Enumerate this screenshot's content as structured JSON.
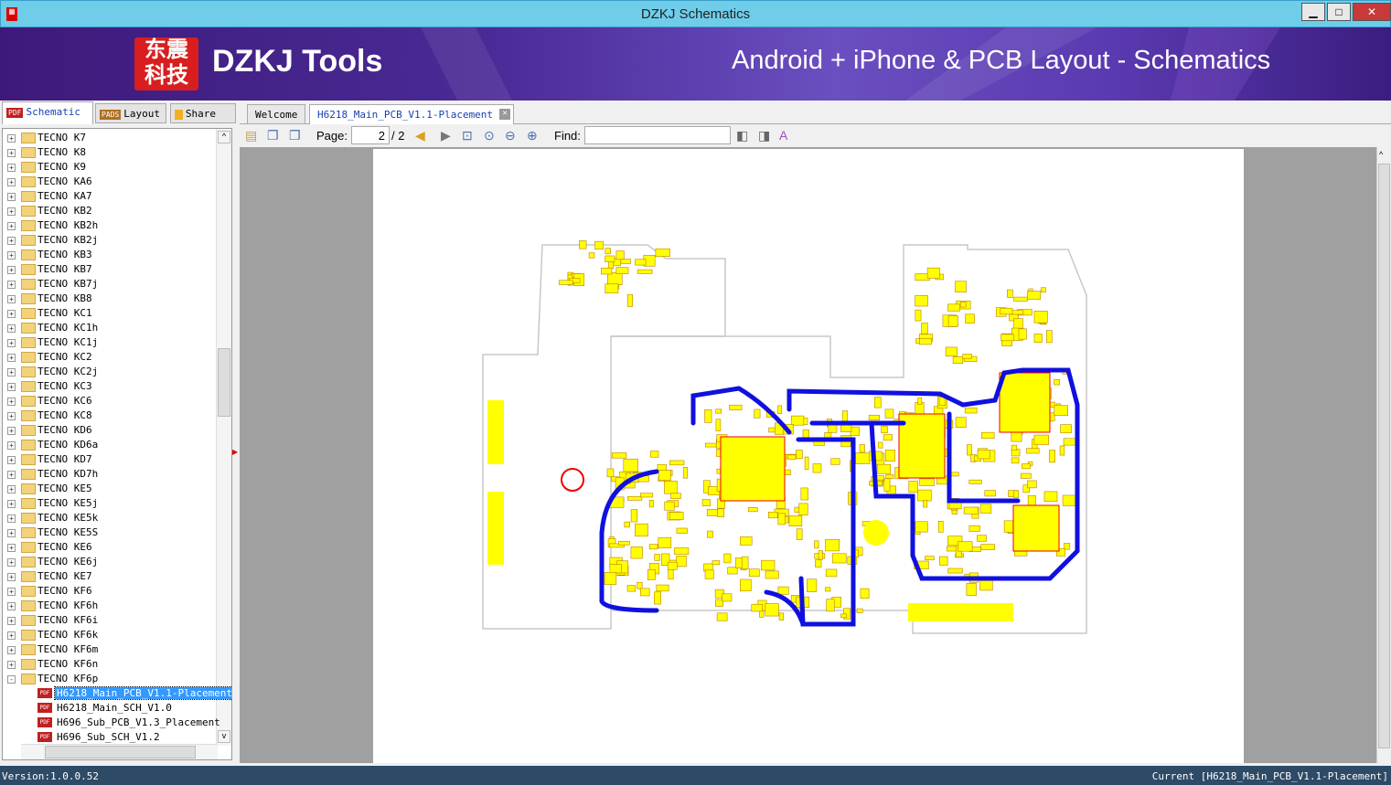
{
  "window": {
    "title": "DZKJ Schematics",
    "minimize": "▁",
    "maximize": "□",
    "close": "✕"
  },
  "banner": {
    "logo_text": "东震科技",
    "brand": "DZKJ Tools",
    "tagline": "Android + iPhone & PCB Layout - Schematics"
  },
  "left_tabs": [
    {
      "label": "Schematic",
      "icon": "PDF"
    },
    {
      "label": "Layout",
      "icon": "PADS"
    },
    {
      "label": "Share",
      "icon": "cloud"
    }
  ],
  "tree": {
    "folders": [
      "TECNO K7",
      "TECNO K8",
      "TECNO K9",
      "TECNO KA6",
      "TECNO KA7",
      "TECNO KB2",
      "TECNO KB2h",
      "TECNO KB2j",
      "TECNO KB3",
      "TECNO KB7",
      "TECNO KB7j",
      "TECNO KB8",
      "TECNO KC1",
      "TECNO KC1h",
      "TECNO KC1j",
      "TECNO KC2",
      "TECNO KC2j",
      "TECNO KC3",
      "TECNO KC6",
      "TECNO KC8",
      "TECNO KD6",
      "TECNO KD6a",
      "TECNO KD7",
      "TECNO KD7h",
      "TECNO KE5",
      "TECNO KE5j",
      "TECNO KE5k",
      "TECNO KE5S",
      "TECNO KE6",
      "TECNO KE6j",
      "TECNO KE7",
      "TECNO KF6",
      "TECNO KF6h",
      "TECNO KF6i",
      "TECNO KF6k",
      "TECNO KF6m",
      "TECNO KF6n",
      "TECNO KF6p"
    ],
    "files": [
      "H6218_Main_PCB_V1.1-Placement",
      "H6218_Main_SCH_V1.0",
      "H696_Sub_PCB_V1.3_Placement",
      "H696_Sub_SCH_V1.2"
    ],
    "selected_file": 0
  },
  "doc_tabs": [
    {
      "label": "Welcome"
    },
    {
      "label": "H6218_Main_PCB_V1.1-Placement",
      "active": true
    }
  ],
  "toolbar": {
    "page_label": "Page:",
    "page_value": "2",
    "page_total": "/ 2",
    "find_label": "Find:",
    "find_value": ""
  },
  "colors": {
    "trace": "#1010e0",
    "component": "#ffff00",
    "outline": "#c8c8c8"
  },
  "status": {
    "version": "Version:1.0.0.52",
    "current": "Current [H6218_Main_PCB_V1.1-Placement]"
  }
}
